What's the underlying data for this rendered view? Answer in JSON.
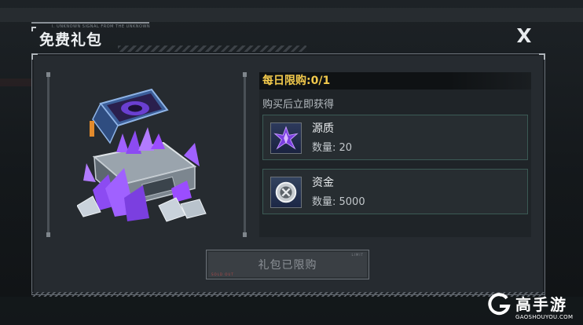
{
  "header": {
    "title": "免费礼包",
    "deco_text": "I. UNKNOWN SIGNAL FROM THE UNKNOWN"
  },
  "offer": {
    "limit_label": "每日限购:0/1",
    "subtitle": "购买后立即获得",
    "items": [
      {
        "name": "源质",
        "count": "数量: 20",
        "icon": "crystal-icon"
      },
      {
        "name": "资金",
        "count": "数量: 5000",
        "icon": "coin-icon"
      }
    ]
  },
  "claim_button": {
    "label": "礼包已限购",
    "tag_left": "SOLD OUT",
    "tag_right": "LIMIT"
  },
  "watermark": {
    "cn": "高手游",
    "en": "GAOSHOUYOU.COM"
  },
  "colors": {
    "accent_gold": "#f2c94c",
    "item_border": "#3b5a55",
    "crystal_purple": "#9b4dff"
  }
}
